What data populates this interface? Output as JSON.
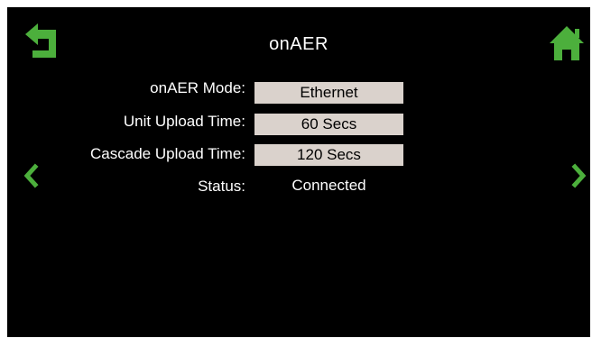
{
  "header": {
    "title": "onAER",
    "back_icon": "back-arrow-icon",
    "home_icon": "home-icon"
  },
  "nav": {
    "prev_icon": "chevron-left-icon",
    "next_icon": "chevron-right-icon"
  },
  "settings": {
    "mode_label": "onAER Mode:",
    "mode_value": "Ethernet",
    "unit_upload_label": "Unit Upload Time:",
    "unit_upload_value": "60 Secs",
    "cascade_upload_label": "Cascade Upload Time:",
    "cascade_upload_value": "120 Secs",
    "status_label": "Status:",
    "status_value": "Connected"
  },
  "colors": {
    "accent": "#4caf3c",
    "background": "#000000",
    "field_background": "#dad2cc"
  }
}
